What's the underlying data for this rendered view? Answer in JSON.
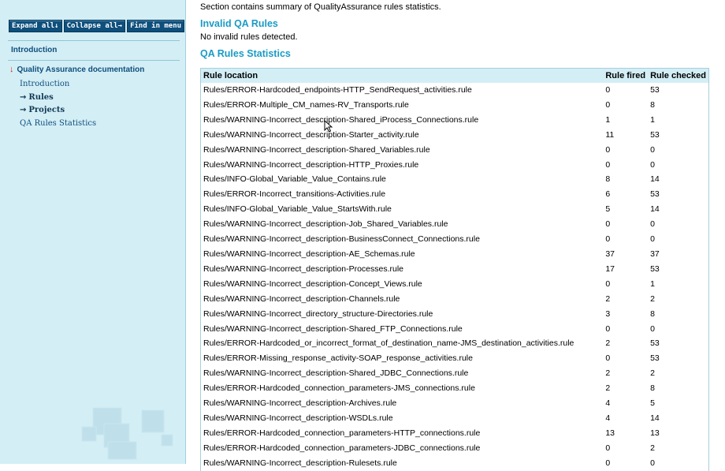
{
  "toolbar": {
    "expand_all": "Expand all↓",
    "collapse_all": "Collapse all→",
    "find_in_menu": "Find in menu"
  },
  "nav": {
    "introduction": "Introduction",
    "section_title": "Quality Assurance documentation",
    "section_arrow": "↓",
    "items": [
      {
        "label": "Introduction",
        "arrow": ""
      },
      {
        "label": "Rules",
        "arrow": "→"
      },
      {
        "label": "Projects",
        "arrow": "→"
      },
      {
        "label": "QA Rules Statistics",
        "arrow": ""
      }
    ]
  },
  "content": {
    "intro_text": "Section contains summary of QualityAssurance rules statistics.",
    "invalid_heading": "Invalid QA Rules",
    "invalid_text": "No invalid rules detected.",
    "stats_heading": "QA Rules Statistics"
  },
  "table": {
    "headers": [
      "Rule location",
      "Rule fired",
      "Rule checked"
    ],
    "rows": [
      [
        "Rules/ERROR-Hardcoded_endpoints-HTTP_SendRequest_activities.rule",
        "0",
        "53"
      ],
      [
        "Rules/ERROR-Multiple_CM_names-RV_Transports.rule",
        "0",
        "8"
      ],
      [
        "Rules/WARNING-Incorrect_description-Shared_iProcess_Connections.rule",
        "1",
        "1"
      ],
      [
        "Rules/WARNING-Incorrect_description-Starter_activity.rule",
        "11",
        "53"
      ],
      [
        "Rules/WARNING-Incorrect_description-Shared_Variables.rule",
        "0",
        "0"
      ],
      [
        "Rules/WARNING-Incorrect_description-HTTP_Proxies.rule",
        "0",
        "0"
      ],
      [
        "Rules/INFO-Global_Variable_Value_Contains.rule",
        "8",
        "14"
      ],
      [
        "Rules/ERROR-Incorrect_transitions-Activities.rule",
        "6",
        "53"
      ],
      [
        "Rules/INFO-Global_Variable_Value_StartsWith.rule",
        "5",
        "14"
      ],
      [
        "Rules/WARNING-Incorrect_description-Job_Shared_Variables.rule",
        "0",
        "0"
      ],
      [
        "Rules/WARNING-Incorrect_description-BusinessConnect_Connections.rule",
        "0",
        "0"
      ],
      [
        "Rules/WARNING-Incorrect_description-AE_Schemas.rule",
        "37",
        "37"
      ],
      [
        "Rules/WARNING-Incorrect_description-Processes.rule",
        "17",
        "53"
      ],
      [
        "Rules/WARNING-Incorrect_description-Concept_Views.rule",
        "0",
        "1"
      ],
      [
        "Rules/WARNING-Incorrect_description-Channels.rule",
        "2",
        "2"
      ],
      [
        "Rules/WARNING-Incorrect_directory_structure-Directories.rule",
        "3",
        "8"
      ],
      [
        "Rules/WARNING-Incorrect_description-Shared_FTP_Connections.rule",
        "0",
        "0"
      ],
      [
        "Rules/ERROR-Hardcoded_or_incorrect_format_of_destination_name-JMS_destination_activities.rule",
        "2",
        "53"
      ],
      [
        "Rules/ERROR-Missing_response_activity-SOAP_response_activities.rule",
        "0",
        "53"
      ],
      [
        "Rules/WARNING-Incorrect_description-Shared_JDBC_Connections.rule",
        "2",
        "2"
      ],
      [
        "Rules/ERROR-Hardcoded_connection_parameters-JMS_connections.rule",
        "2",
        "8"
      ],
      [
        "Rules/WARNING-Incorrect_description-Archives.rule",
        "4",
        "5"
      ],
      [
        "Rules/WARNING-Incorrect_description-WSDLs.rule",
        "4",
        "14"
      ],
      [
        "Rules/ERROR-Hardcoded_connection_parameters-HTTP_connections.rule",
        "13",
        "13"
      ],
      [
        "Rules/ERROR-Hardcoded_connection_parameters-JDBC_connections.rule",
        "0",
        "2"
      ],
      [
        "Rules/WARNING-Incorrect_description-Rulesets.rule",
        "0",
        "0"
      ]
    ]
  },
  "colors": {
    "sidebar_bg": "#d4eef6",
    "button_bg": "#0e4f7c",
    "heading": "#1a9bc5",
    "nav_text": "#0e4f7c",
    "expand_arrow": "#cc2a1c"
  },
  "icons": [
    "expand-arrow-icon",
    "collapse-arrow-icon",
    "mouse-cursor-icon",
    "logo-squares"
  ]
}
